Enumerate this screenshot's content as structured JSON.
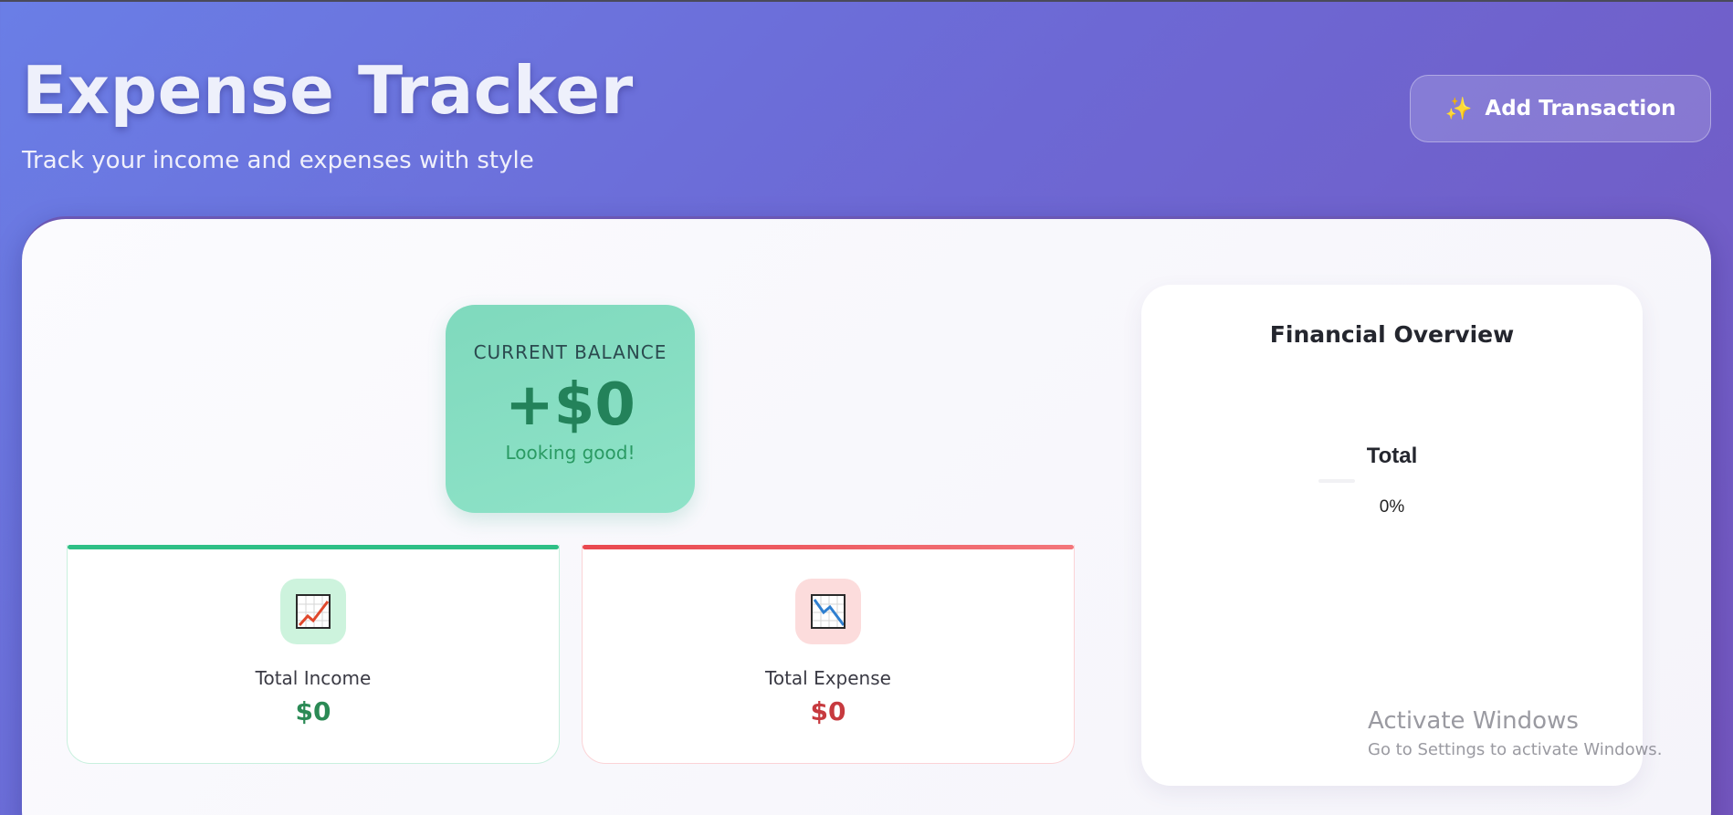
{
  "header": {
    "title": "Expense Tracker",
    "subtitle": "Track your income and expenses with style"
  },
  "actions": {
    "add_transaction_label": "Add Transaction",
    "add_transaction_icon": "sparkles-icon"
  },
  "balance": {
    "label": "CURRENT BALANCE",
    "value": "+$0",
    "note": "Looking good!"
  },
  "income": {
    "label": "Total Income",
    "value": "$0",
    "icon": "chart-increasing-icon",
    "accent": "#2ebf86"
  },
  "expense": {
    "label": "Total Expense",
    "value": "$0",
    "icon": "chart-decreasing-icon",
    "accent": "#e9484f"
  },
  "overview": {
    "title": "Financial Overview",
    "center_label": "Total",
    "center_value": "0%"
  },
  "system": {
    "watermark_line1": "Activate Windows",
    "watermark_line2": "Go to Settings to activate Windows."
  },
  "colors": {
    "background_start": "#6a7ee6",
    "background_end": "#7456be",
    "balance_positive": "#23825a"
  }
}
